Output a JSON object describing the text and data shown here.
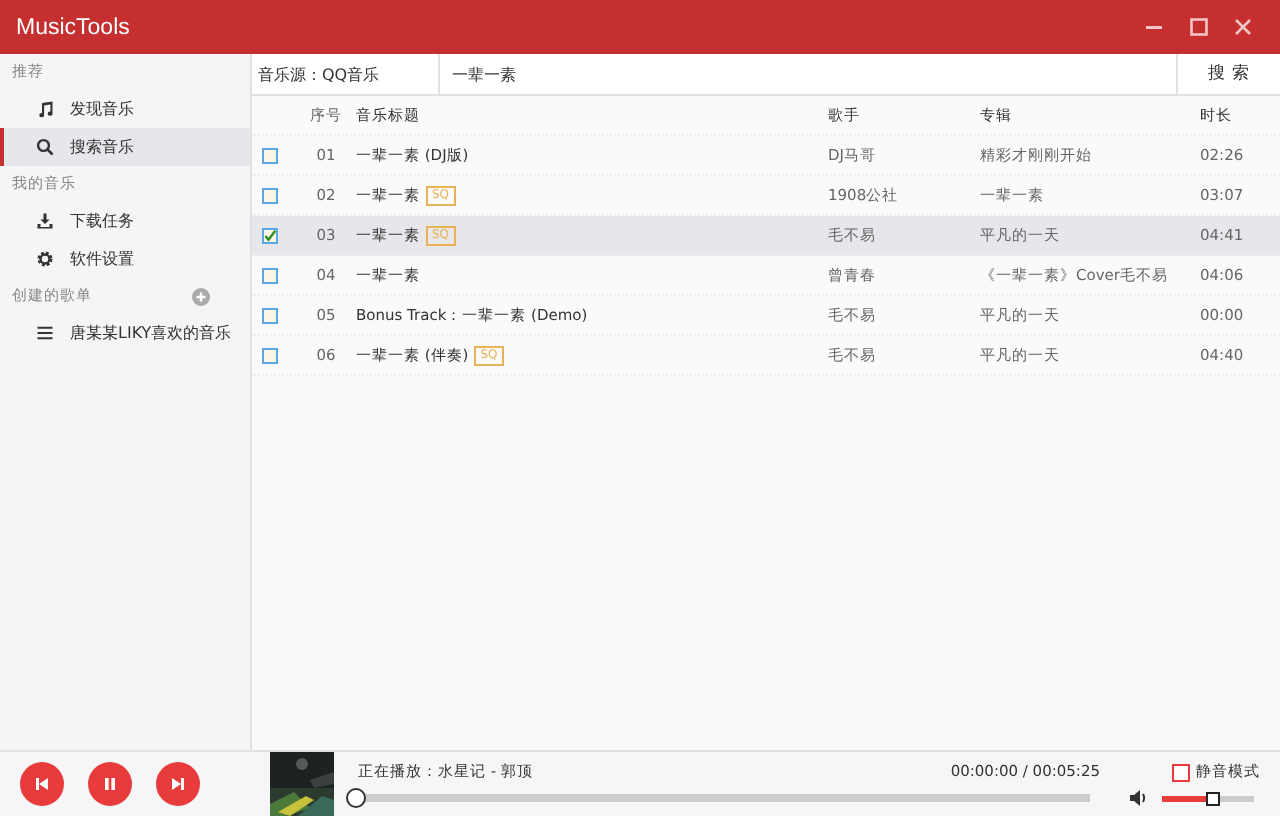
{
  "window": {
    "title": "MusicTools"
  },
  "sidebar": {
    "sections": [
      {
        "heading": "推荐",
        "items": [
          {
            "kind": "music",
            "label": "发现音乐",
            "selected": false
          },
          {
            "kind": "search",
            "label": "搜索音乐",
            "selected": true
          }
        ]
      },
      {
        "heading": "我的音乐",
        "items": [
          {
            "kind": "download",
            "label": "下载任务",
            "selected": false
          },
          {
            "kind": "gear",
            "label": "软件设置",
            "selected": false
          }
        ]
      },
      {
        "heading": "创建的歌单",
        "add": true,
        "items": [
          {
            "kind": "list",
            "label": "唐某某LIKY喜欢的音乐",
            "selected": false
          }
        ]
      }
    ]
  },
  "search": {
    "source": "音乐源：QQ音乐",
    "value": "一辈一素",
    "button": "搜 索"
  },
  "table": {
    "columns": [
      "序号",
      "音乐标题",
      "歌手",
      "专辑",
      "时长"
    ],
    "rows": [
      {
        "checked": false,
        "selected": false,
        "no": "01",
        "title": "一辈一素 (DJ版)",
        "artist": "DJ马哥",
        "album": "精彩才刚刚开始",
        "duration": "02:26"
      },
      {
        "checked": false,
        "selected": false,
        "no": "02",
        "title": "一辈一素",
        "badge": "SQ",
        "artist": "1908公社",
        "album": "一辈一素",
        "duration": "03:07"
      },
      {
        "checked": true,
        "selected": true,
        "no": "03",
        "title": "一辈一素",
        "badge": "SQ",
        "artist": "毛不易",
        "album": "平凡的一天",
        "duration": "04:41"
      },
      {
        "checked": false,
        "selected": false,
        "no": "04",
        "title": "一辈一素",
        "artist": "曾青春",
        "album": "《一辈一素》Cover毛不易",
        "duration": "04:06"
      },
      {
        "checked": false,
        "selected": false,
        "no": "05",
        "title": "Bonus Track：一辈一素 (Demo)",
        "artist": "毛不易",
        "album": "平凡的一天",
        "duration": "00:00"
      },
      {
        "checked": false,
        "selected": false,
        "no": "06",
        "title": "一辈一素 (伴奏)",
        "badge": "SQ",
        "artist": "毛不易",
        "album": "平凡的一天",
        "duration": "04:40"
      }
    ]
  },
  "player": {
    "now_playing": "正在播放：水星记 - 郭顶",
    "time": "00:00:00 / 00:05:25",
    "progress": {
      "level": 0
    },
    "volume": {
      "level": 0.55
    },
    "mute": {
      "label": "静音模式",
      "checked": false
    }
  }
}
